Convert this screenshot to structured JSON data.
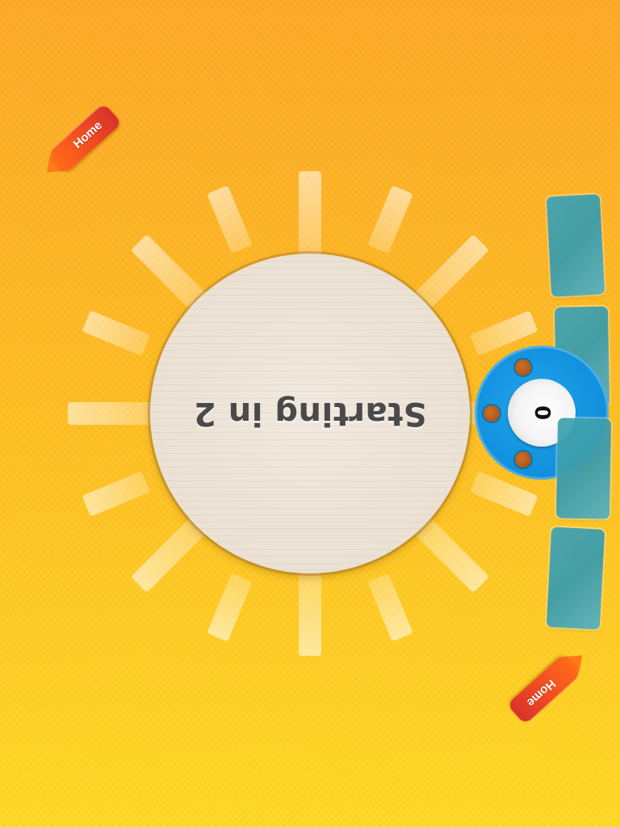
{
  "game": {
    "countdown_text": "Starting in 2",
    "player_score": "0"
  },
  "buttons": {
    "home_top_label": "Home",
    "home_bottom_label": "Home"
  },
  "colors": {
    "background_top": "#fca826",
    "background_bottom": "#fed824",
    "disc": "#ede3d6",
    "player_dial": "#1799e3",
    "tile": "#43a5b3",
    "home_button": "#f04a22"
  },
  "icons": {
    "home_arrow": "arrow-left-icon"
  }
}
